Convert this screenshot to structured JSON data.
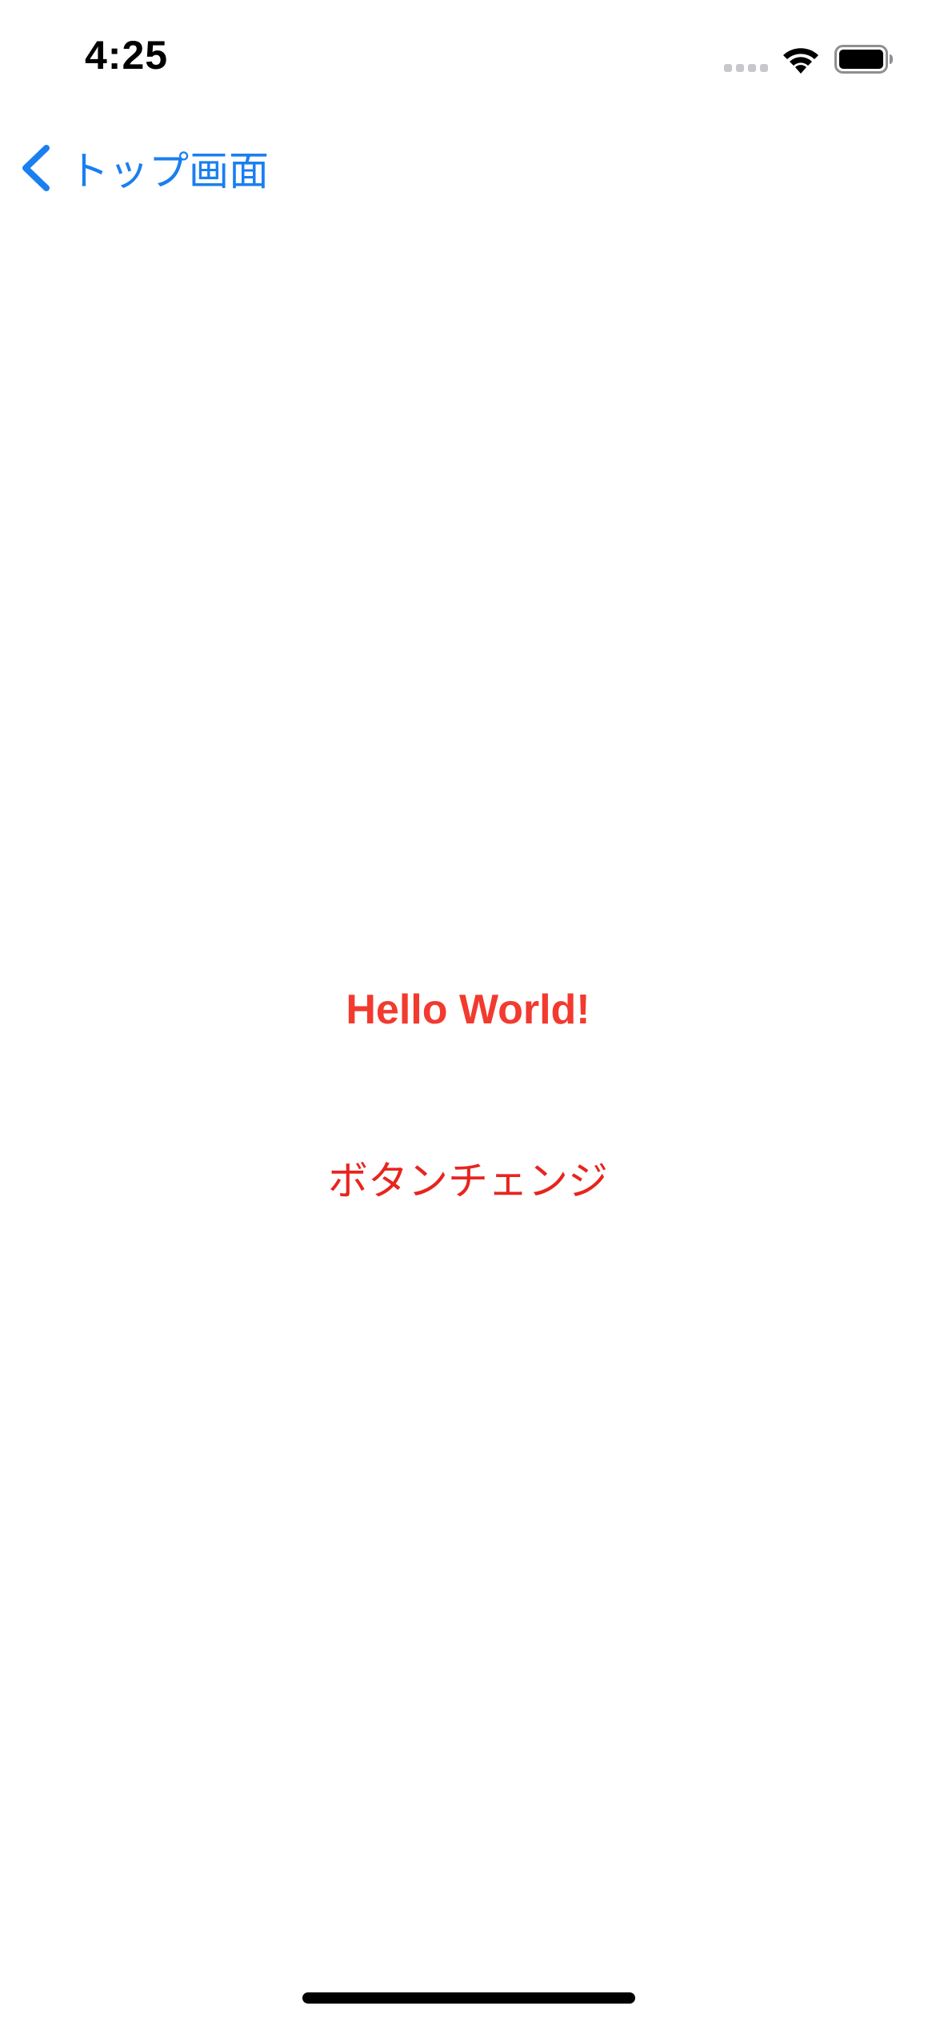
{
  "status_bar": {
    "time": "4:25",
    "icons": [
      "signal-icon",
      "wifi-icon",
      "battery-icon"
    ]
  },
  "nav": {
    "back_label": "トップ画面",
    "back_icon": "chevron-left-icon",
    "accent_color": "#1a7ff0"
  },
  "main": {
    "hello_text": "Hello World!",
    "hello_color": "#f23a2f",
    "button_label": "ボタンチェンジ",
    "button_color": "#e8241f"
  }
}
